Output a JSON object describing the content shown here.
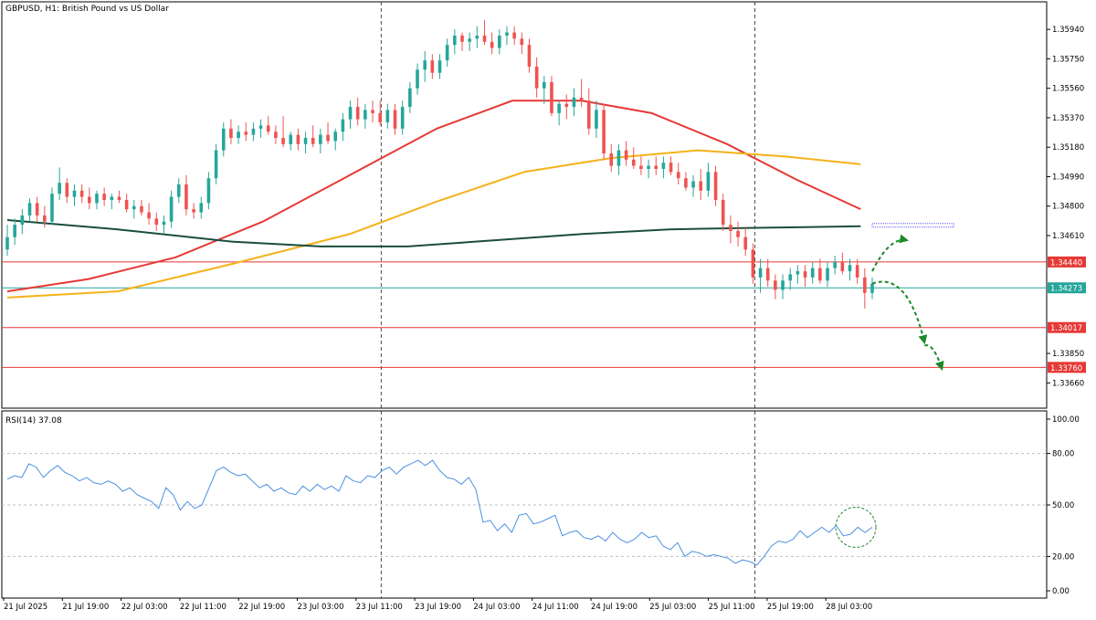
{
  "chart_data": {
    "type": "candlestick",
    "symbol_label": "GBPUSD, H1:  British Pound vs US Dollar",
    "main_panel": {
      "ylim": [
        1.3355,
        1.361
      ],
      "y_ticks": [
        "1.35940",
        "1.35750",
        "1.35560",
        "1.35370",
        "1.35180",
        "1.34990",
        "1.34800",
        "1.34610",
        "1.34440",
        "1.34273",
        "1.34017",
        "1.33850",
        "1.33760",
        "1.33660"
      ],
      "candle_colors": {
        "up": "#26a69a",
        "down": "#ef5350"
      },
      "candles_x_range": [
        1,
        150
      ],
      "candles": [
        [
          1.3452,
          1.3468,
          1.3448,
          1.346
        ],
        [
          1.346,
          1.3472,
          1.3455,
          1.3468
        ],
        [
          1.3468,
          1.3478,
          1.3462,
          1.3474
        ],
        [
          1.3474,
          1.3485,
          1.347,
          1.3482
        ],
        [
          1.3482,
          1.3486,
          1.347,
          1.3474
        ],
        [
          1.3474,
          1.348,
          1.3466,
          1.347
        ],
        [
          1.347,
          1.3492,
          1.3468,
          1.3488
        ],
        [
          1.3488,
          1.3505,
          1.3484,
          1.3495
        ],
        [
          1.3495,
          1.3498,
          1.3482,
          1.3486
        ],
        [
          1.3486,
          1.3494,
          1.348,
          1.349
        ],
        [
          1.349,
          1.3494,
          1.3482,
          1.3486
        ],
        [
          1.3486,
          1.3492,
          1.3478,
          1.3482
        ],
        [
          1.3482,
          1.349,
          1.3478,
          1.3488
        ],
        [
          1.3488,
          1.3492,
          1.348,
          1.3484
        ],
        [
          1.3484,
          1.3488,
          1.3478,
          1.3486
        ],
        [
          1.3486,
          1.349,
          1.3482,
          1.3484
        ],
        [
          1.3484,
          1.3488,
          1.3476,
          1.3478
        ],
        [
          1.3478,
          1.3484,
          1.3472,
          1.348
        ],
        [
          1.348,
          1.3484,
          1.3474,
          1.3476
        ],
        [
          1.3476,
          1.3482,
          1.3468,
          1.3472
        ],
        [
          1.3472,
          1.3476,
          1.3464,
          1.3468
        ],
        [
          1.3468,
          1.3474,
          1.3462,
          1.347
        ],
        [
          1.347,
          1.349,
          1.3466,
          1.3486
        ],
        [
          1.3486,
          1.3498,
          1.3482,
          1.3494
        ],
        [
          1.3494,
          1.35,
          1.3474,
          1.3478
        ],
        [
          1.3478,
          1.3482,
          1.3472,
          1.3476
        ],
        [
          1.3476,
          1.3486,
          1.3472,
          1.3482
        ],
        [
          1.3482,
          1.3502,
          1.3478,
          1.3498
        ],
        [
          1.3498,
          1.352,
          1.3494,
          1.3516
        ],
        [
          1.3516,
          1.3534,
          1.3512,
          1.353
        ],
        [
          1.353,
          1.3536,
          1.352,
          1.3524
        ],
        [
          1.3524,
          1.3532,
          1.352,
          1.3528
        ],
        [
          1.3528,
          1.3534,
          1.3522,
          1.3526
        ],
        [
          1.3526,
          1.3534,
          1.3522,
          1.353
        ],
        [
          1.353,
          1.3536,
          1.3524,
          1.3532
        ],
        [
          1.3532,
          1.3538,
          1.3526,
          1.3528
        ],
        [
          1.3528,
          1.3532,
          1.352,
          1.3524
        ],
        [
          1.3524,
          1.3538,
          1.3518,
          1.352
        ],
        [
          1.352,
          1.3528,
          1.3516,
          1.3526
        ],
        [
          1.3526,
          1.353,
          1.3516,
          1.352
        ],
        [
          1.352,
          1.3528,
          1.3514,
          1.3524
        ],
        [
          1.3524,
          1.3532,
          1.3518,
          1.352
        ],
        [
          1.352,
          1.353,
          1.3514,
          1.3526
        ],
        [
          1.3526,
          1.3534,
          1.352,
          1.3522
        ],
        [
          1.3522,
          1.353,
          1.3516,
          1.3528
        ],
        [
          1.3528,
          1.354,
          1.3522,
          1.3536
        ],
        [
          1.3536,
          1.3548,
          1.353,
          1.3544
        ],
        [
          1.3544,
          1.355,
          1.3532,
          1.3536
        ],
        [
          1.3536,
          1.3546,
          1.353,
          1.3542
        ],
        [
          1.3542,
          1.3548,
          1.3534,
          1.354
        ],
        [
          1.354,
          1.3548,
          1.3532,
          1.3534
        ],
        [
          1.3534,
          1.3546,
          1.353,
          1.3542
        ],
        [
          1.3542,
          1.3546,
          1.3526,
          1.353
        ],
        [
          1.353,
          1.3548,
          1.3526,
          1.3544
        ],
        [
          1.3544,
          1.356,
          1.354,
          1.3556
        ],
        [
          1.3556,
          1.3572,
          1.3552,
          1.3568
        ],
        [
          1.3568,
          1.358,
          1.356,
          1.3574
        ],
        [
          1.3574,
          1.3578,
          1.3562,
          1.3566
        ],
        [
          1.3566,
          1.3578,
          1.3562,
          1.3574
        ],
        [
          1.3574,
          1.3588,
          1.357,
          1.3584
        ],
        [
          1.3584,
          1.3594,
          1.3578,
          1.359
        ],
        [
          1.359,
          1.3592,
          1.358,
          1.3586
        ],
        [
          1.3586,
          1.3592,
          1.358,
          1.3588
        ],
        [
          1.3588,
          1.3596,
          1.3582,
          1.359
        ],
        [
          1.359,
          1.36,
          1.3584,
          1.3586
        ],
        [
          1.3586,
          1.3592,
          1.3578,
          1.3582
        ],
        [
          1.3582,
          1.3594,
          1.3578,
          1.359
        ],
        [
          1.359,
          1.3596,
          1.3584,
          1.3592
        ],
        [
          1.3592,
          1.3596,
          1.3584,
          1.3588
        ],
        [
          1.3588,
          1.3592,
          1.3578,
          1.3584
        ],
        [
          1.3584,
          1.3588,
          1.3566,
          1.357
        ],
        [
          1.357,
          1.3576,
          1.355,
          1.3556
        ],
        [
          1.3556,
          1.3564,
          1.3546,
          1.356
        ],
        [
          1.356,
          1.3564,
          1.3538,
          1.354
        ],
        [
          1.354,
          1.3548,
          1.3532,
          1.3546
        ],
        [
          1.3546,
          1.3552,
          1.3536,
          1.3544
        ],
        [
          1.3544,
          1.3556,
          1.3538,
          1.355
        ],
        [
          1.355,
          1.3562,
          1.3544,
          1.3548
        ],
        [
          1.3548,
          1.3556,
          1.3526,
          1.353
        ],
        [
          1.353,
          1.3548,
          1.3524,
          1.3542
        ],
        [
          1.3542,
          1.3546,
          1.351,
          1.3514
        ],
        [
          1.3514,
          1.352,
          1.3502,
          1.3506
        ],
        [
          1.3506,
          1.352,
          1.35,
          1.3516
        ],
        [
          1.3516,
          1.3522,
          1.3506,
          1.351
        ],
        [
          1.351,
          1.3518,
          1.3504,
          1.3506
        ],
        [
          1.3506,
          1.3512,
          1.35,
          1.3504
        ],
        [
          1.3504,
          1.351,
          1.3498,
          1.3506
        ],
        [
          1.3506,
          1.3512,
          1.35,
          1.3504
        ],
        [
          1.3504,
          1.3512,
          1.3498,
          1.3508
        ],
        [
          1.3508,
          1.3512,
          1.35,
          1.3502
        ],
        [
          1.3502,
          1.3508,
          1.3494,
          1.3498
        ],
        [
          1.3498,
          1.3502,
          1.349,
          1.3492
        ],
        [
          1.3492,
          1.35,
          1.3486,
          1.3496
        ],
        [
          1.3496,
          1.3504,
          1.3484,
          1.349
        ],
        [
          1.349,
          1.3508,
          1.3486,
          1.3502
        ],
        [
          1.3502,
          1.3506,
          1.348,
          1.3484
        ],
        [
          1.3484,
          1.3488,
          1.3464,
          1.3468
        ],
        [
          1.3468,
          1.3474,
          1.3456,
          1.3464
        ],
        [
          1.3464,
          1.347,
          1.3454,
          1.346
        ],
        [
          1.346,
          1.3466,
          1.3448,
          1.3452
        ],
        [
          1.3452,
          1.3456,
          1.343,
          1.3434
        ],
        [
          1.3434,
          1.3446,
          1.3424,
          1.344
        ],
        [
          1.344,
          1.3446,
          1.3428,
          1.3432
        ],
        [
          1.3432,
          1.3436,
          1.342,
          1.3426
        ],
        [
          1.3426,
          1.3436,
          1.342,
          1.3432
        ],
        [
          1.3432,
          1.344,
          1.3426,
          1.3436
        ],
        [
          1.3436,
          1.3442,
          1.343,
          1.3438
        ],
        [
          1.3438,
          1.3442,
          1.3428,
          1.3434
        ],
        [
          1.3434,
          1.3444,
          1.343,
          1.344
        ],
        [
          1.344,
          1.3446,
          1.343,
          1.3432
        ],
        [
          1.3432,
          1.3444,
          1.3428,
          1.344
        ],
        [
          1.344,
          1.3448,
          1.3436,
          1.3444
        ],
        [
          1.3444,
          1.345,
          1.3436,
          1.3438
        ],
        [
          1.3438,
          1.3446,
          1.3432,
          1.3442
        ],
        [
          1.3442,
          1.3446,
          1.343,
          1.3434
        ],
        [
          1.3434,
          1.344,
          1.3414,
          1.3424
        ],
        [
          1.3424,
          1.3434,
          1.342,
          1.343
        ]
      ],
      "moving_averages": [
        {
          "color": "#e53935",
          "points": [
            [
              1,
              1.3425
            ],
            [
              15,
              1.3433
            ],
            [
              30,
              1.3447
            ],
            [
              45,
              1.347
            ],
            [
              60,
              1.35
            ],
            [
              75,
              1.353
            ],
            [
              88,
              1.3548
            ],
            [
              100,
              1.3548
            ],
            [
              112,
              1.354
            ],
            [
              125,
              1.352
            ],
            [
              137,
              1.3497
            ],
            [
              148,
              1.3478
            ]
          ]
        },
        {
          "color": "#f5b21a",
          "points": [
            [
              1,
              1.3421
            ],
            [
              20,
              1.3425
            ],
            [
              40,
              1.3443
            ],
            [
              60,
              1.3462
            ],
            [
              75,
              1.3483
            ],
            [
              90,
              1.3502
            ],
            [
              105,
              1.3511
            ],
            [
              120,
              1.3516
            ],
            [
              135,
              1.3512
            ],
            [
              148,
              1.3507
            ]
          ]
        },
        {
          "color": "#1b4d3e",
          "points": [
            [
              1,
              1.3471
            ],
            [
              20,
              1.3465
            ],
            [
              40,
              1.3457
            ],
            [
              55,
              1.3454
            ],
            [
              70,
              1.3454
            ],
            [
              85,
              1.3458
            ],
            [
              100,
              1.3462
            ],
            [
              115,
              1.3465
            ],
            [
              130,
              1.3466
            ],
            [
              148,
              1.3467
            ]
          ]
        }
      ],
      "horizontal_lines": [
        {
          "price": 1.3444,
          "color": "#e53935",
          "label": "1.34440"
        },
        {
          "price": 1.34273,
          "color": "#26a69a",
          "label": "1.34273"
        },
        {
          "price": 1.34017,
          "color": "#e53935",
          "label": "1.34017"
        },
        {
          "price": 1.3376,
          "color": "#e53935",
          "label": "1.33760"
        }
      ],
      "target_marker": {
        "price": 1.34676,
        "color": "#5c5cff"
      },
      "forecast_arrows": [
        {
          "from": [
            150,
            1.3438
          ],
          "to": [
            156,
            1.3458
          ]
        },
        {
          "from": [
            150,
            1.343
          ],
          "to": [
            159,
            1.3392
          ]
        },
        {
          "from": [
            159,
            1.339
          ],
          "to": [
            162,
            1.3375
          ]
        }
      ]
    },
    "rsi_panel": {
      "label": "RSI(14) 37.08",
      "ylim": [
        0,
        100
      ],
      "y_ticks": [
        "100.00",
        "80.00",
        "50.00",
        "20.00",
        "0.00"
      ],
      "levels": [
        80,
        50,
        20
      ],
      "line_color": "#4a90e2",
      "values": [
        65,
        67,
        66,
        74,
        72,
        66,
        70,
        73,
        69,
        67,
        64,
        66,
        63,
        62,
        64,
        62,
        58,
        60,
        56,
        54,
        52,
        48,
        60,
        56,
        47,
        52,
        48,
        50,
        60,
        70,
        72,
        69,
        67,
        68,
        64,
        60,
        62,
        58,
        60,
        57,
        56,
        61,
        58,
        62,
        59,
        61,
        58,
        67,
        64,
        63,
        67,
        66,
        70,
        72,
        68,
        72,
        74,
        76,
        73,
        76,
        70,
        66,
        65,
        62,
        66,
        59,
        40,
        41,
        35,
        39,
        34,
        44,
        45,
        39,
        40,
        42,
        44,
        32,
        34,
        35,
        31,
        30,
        32,
        29,
        34,
        30,
        28,
        30,
        34,
        31,
        32,
        26,
        24,
        28,
        20,
        23,
        22,
        20,
        21,
        20,
        19,
        16,
        18,
        17,
        15,
        20,
        26,
        29,
        28,
        30,
        35,
        31,
        34,
        37,
        34,
        38,
        32,
        33,
        37,
        34,
        37
      ],
      "highlight_circle": {
        "center_index": 150,
        "center_value": 37
      }
    },
    "x_ticks": [
      "21 Jul 2025",
      "21 Jul 19:00",
      "22 Jul 03:00",
      "22 Jul 11:00",
      "22 Jul 19:00",
      "23 Jul 03:00",
      "23 Jul 11:00",
      "23 Jul 19:00",
      "24 Jul 03:00",
      "24 Jul 11:00",
      "24 Jul 19:00",
      "25 Jul 03:00",
      "25 Jul 11:00",
      "25 Jul 19:00",
      "28 Jul 03:00"
    ],
    "x_ticks_sep": [
      8,
      16,
      24,
      32,
      40,
      48,
      56,
      64,
      72,
      80,
      88,
      96,
      104,
      112
    ],
    "axis_color": "#000000",
    "grid_color": "#c0c0c0"
  }
}
